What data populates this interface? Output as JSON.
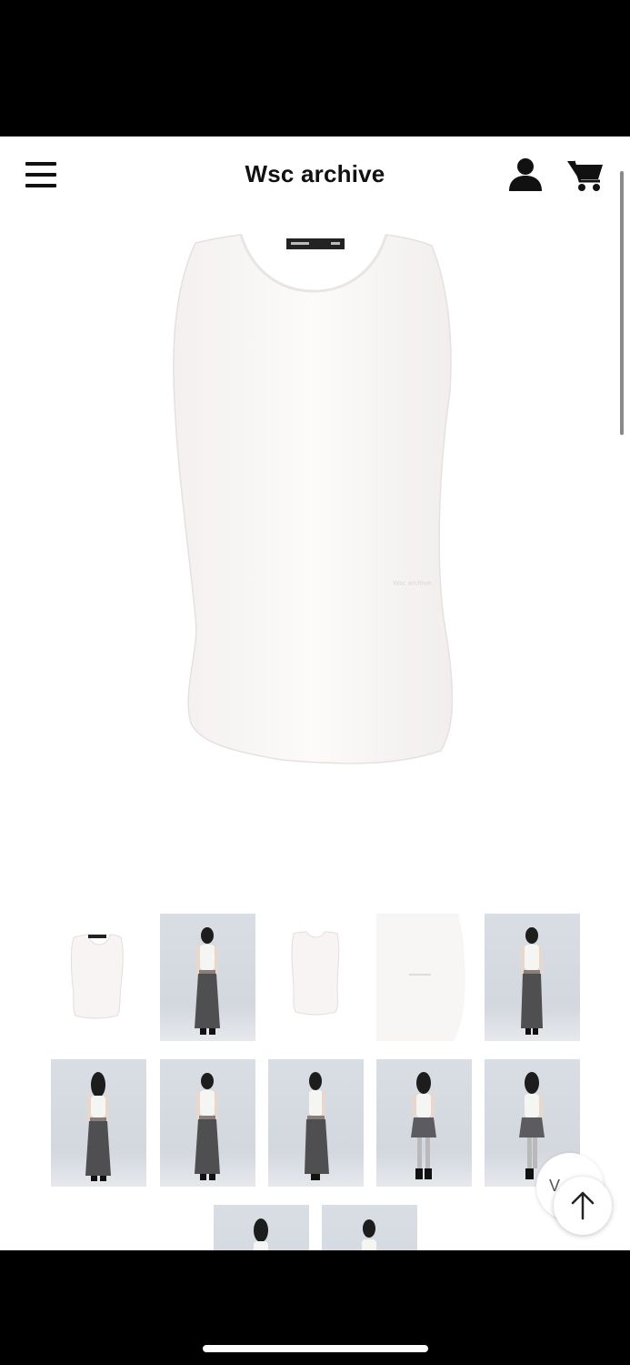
{
  "header": {
    "title": "Wsc archive",
    "menu_icon": "hamburger-menu-icon",
    "account_icon": "user-icon",
    "cart_icon": "shopping-cart-icon"
  },
  "product": {
    "main_image": "white-sleeveless-tank-top",
    "label_text": "Wsc archive"
  },
  "gallery": {
    "thumbnails": [
      {
        "kind": "product-front"
      },
      {
        "kind": "model-front-maxi-skirt"
      },
      {
        "kind": "product-back"
      },
      {
        "kind": "fabric-detail"
      },
      {
        "kind": "model-front-maxi-skirt"
      },
      {
        "kind": "model-back-maxi-skirt"
      },
      {
        "kind": "model-front-maxi-skirt"
      },
      {
        "kind": "model-side-maxi-skirt"
      },
      {
        "kind": "model-front-mini-skirt"
      },
      {
        "kind": "model-side-mini-skirt"
      },
      {
        "kind": "model-back"
      },
      {
        "kind": "model-front"
      }
    ]
  },
  "floating": {
    "partial_button_text": "V",
    "scroll_top_icon": "arrow-up-icon"
  },
  "colors": {
    "background": "#ffffff",
    "text": "#111111",
    "studio_bg": "#d5d9e0",
    "skirt": "#4f4f52"
  }
}
